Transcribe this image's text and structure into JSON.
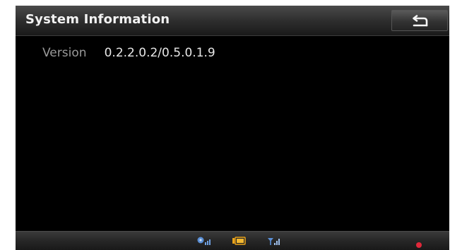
{
  "header": {
    "title": "System Information",
    "back_icon": "back-arrow-icon"
  },
  "info": {
    "version_label": "Version",
    "version_value": "0.2.2.0.2/0.5.0.1.9"
  },
  "statusbar": {
    "icons": [
      "gps-icon",
      "battery-icon",
      "signal-icon",
      "record-indicator-icon"
    ],
    "colors": {
      "gps": "#5a8fd6",
      "battery": "#e8a21a",
      "signal": "#5a8fd6",
      "record": "#e0283a"
    }
  }
}
